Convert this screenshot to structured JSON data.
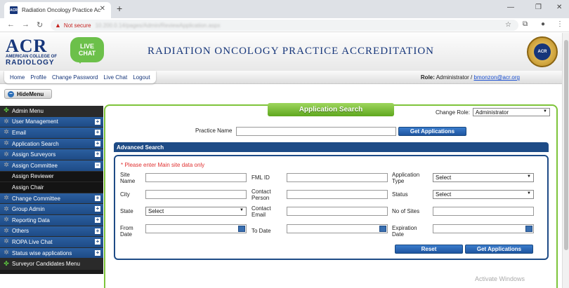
{
  "browser": {
    "tab_favicon": "ACR",
    "tab_title": "Radiation Oncology Practice Acc",
    "not_secure": "Not secure",
    "url": "10.200.0.14/pages/Admin/ReviewApplication.aspx"
  },
  "header": {
    "logo_big": "ACR",
    "logo_small": "AMERICAN COLLEGE OF",
    "logo_rad": "RADIOLOGY",
    "livechat_top": "LIVE",
    "livechat_bottom": "CHAT",
    "title": "RADIATION ONCOLOGY PRACTICE ACCREDITATION",
    "seal_text": "ACR"
  },
  "topmenu": [
    "Home",
    "Profile",
    "Change Password",
    "Live Chat",
    "Logout"
  ],
  "role": {
    "label": "Role:",
    "value": "Administrator /",
    "email": "bmonzon@acr.org"
  },
  "hide_menu": "HideMenu",
  "sidebar": [
    {
      "label": "Admin Menu",
      "style": "dark",
      "icon": "green"
    },
    {
      "label": "User Management",
      "style": "blue",
      "pm": "+"
    },
    {
      "label": "Email",
      "style": "blue",
      "pm": "+"
    },
    {
      "label": "Application Search",
      "style": "blue",
      "pm": "+"
    },
    {
      "label": "Assign Surveyors",
      "style": "blue",
      "pm": "+"
    },
    {
      "label": "Assign Committee",
      "style": "blue",
      "pm": "−"
    },
    {
      "label": "Assign Reviewer",
      "style": "sub"
    },
    {
      "label": "Assign Chair",
      "style": "sub"
    },
    {
      "label": "Change Committee",
      "style": "blue",
      "pm": "+"
    },
    {
      "label": "Group Admin",
      "style": "blue",
      "pm": "+"
    },
    {
      "label": "Reporting Data",
      "style": "blue",
      "pm": "+"
    },
    {
      "label": "Others",
      "style": "blue",
      "pm": "+"
    },
    {
      "label": "ROPA Live Chat",
      "style": "blue",
      "pm": "+"
    },
    {
      "label": "Status wise applications",
      "style": "blue",
      "pm": "+"
    },
    {
      "label": "Surveyor Candidates Menu",
      "style": "dark",
      "icon": "green"
    }
  ],
  "main": {
    "tab_title": "Application Search",
    "change_role_label": "Change Role:",
    "change_role_value": "Administrator",
    "practice_name_label": "Practice Name",
    "get_applications": "Get  Applications",
    "advanced_search": "Advanced Search",
    "error": "* Please enter Main site data only",
    "labels": {
      "site_name": "Site\nName",
      "fml_id": "FML ID",
      "application_type": "Application\nType",
      "city": "City",
      "contact_person": "Contact\nPerson",
      "status": "Status",
      "state": "State",
      "contact_email": "Contact\nEmail",
      "no_of_sites": "No of Sites",
      "from_date": "From\nDate",
      "to_date": "To Date",
      "expiration_date": "Expiration\nDate"
    },
    "select_placeholder": "Select",
    "reset": "Reset",
    "get_applications_2": "Get  Applications"
  },
  "watermark": "Activate Windows"
}
